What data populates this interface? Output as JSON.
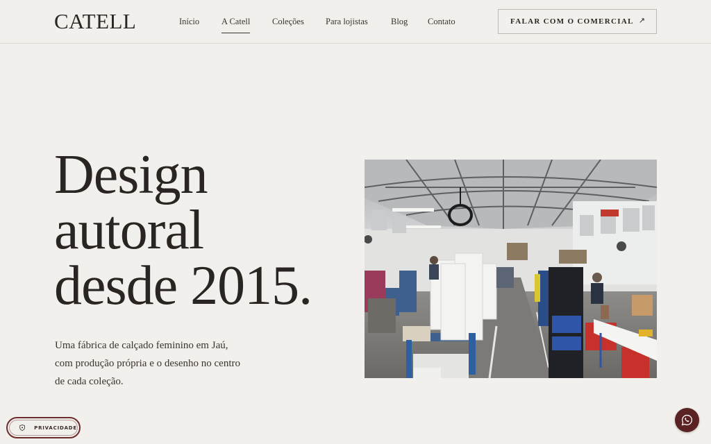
{
  "header": {
    "logo": "CATELL",
    "nav": [
      {
        "label": "Início",
        "active": false
      },
      {
        "label": "A Catell",
        "active": true
      },
      {
        "label": "Coleções",
        "active": false
      },
      {
        "label": "Para lojistas",
        "active": false
      },
      {
        "label": "Blog",
        "active": false
      },
      {
        "label": "Contato",
        "active": false
      }
    ],
    "cta_label": "FALAR COM O COMERCIAL",
    "cta_arrow": "↗"
  },
  "hero": {
    "title_lines": [
      "Design",
      "autoral",
      "desde 2015."
    ],
    "description": "Uma fábrica de calçado feminino em Jaú, com produção própria e o desenho no centro de cada coleção."
  },
  "privacy": {
    "label": "PRIVACIDADE"
  },
  "colors": {
    "background": "#f2f0ec",
    "text": "#2a2522",
    "accent": "#5a2222"
  },
  "icons": {
    "privacy": "shield-icon",
    "whatsapp": "whatsapp-icon",
    "cta": "arrow-up-right-icon"
  }
}
